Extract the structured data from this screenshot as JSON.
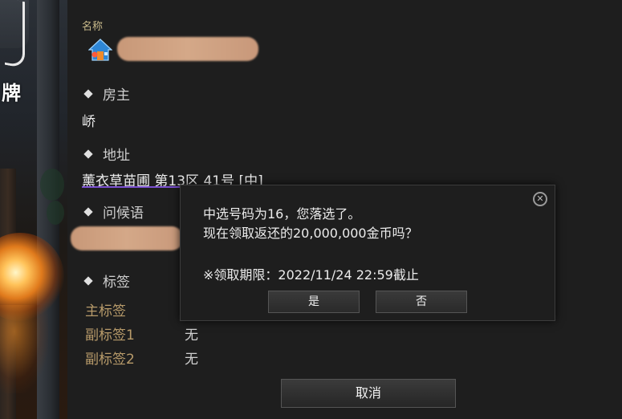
{
  "world": {
    "sign_char": "牌"
  },
  "form": {
    "name_label": "名称",
    "owner_label": "房主",
    "owner_value": "峤",
    "address_label": "地址",
    "address_value": "薰衣草苗圃 第13区 41号 [中]",
    "greeting_label": "问候语",
    "tags_label": "标签",
    "main_tag_label": "主标签",
    "sub_tag1_label": "副标签1",
    "sub_tag1_value": "无",
    "sub_tag2_label": "副标签2",
    "sub_tag2_value": "无"
  },
  "dialog": {
    "line1": "中选号码为16，您落选了。",
    "line2": "现在领取返还的20,000,000金币吗？",
    "line3": "※领取期限：2022/11/24 22:59截止",
    "yes_label": "是",
    "no_label": "否",
    "close_symbol": "✕"
  },
  "footer": {
    "cancel_label": "取消"
  },
  "icons": {
    "house": "house-icon",
    "close": "close-icon",
    "bullet": "diamond-icon"
  },
  "colors": {
    "accent_underline": "#7a4fd0",
    "tag_label": "#b89b6a",
    "background": "#1e1e1e"
  }
}
